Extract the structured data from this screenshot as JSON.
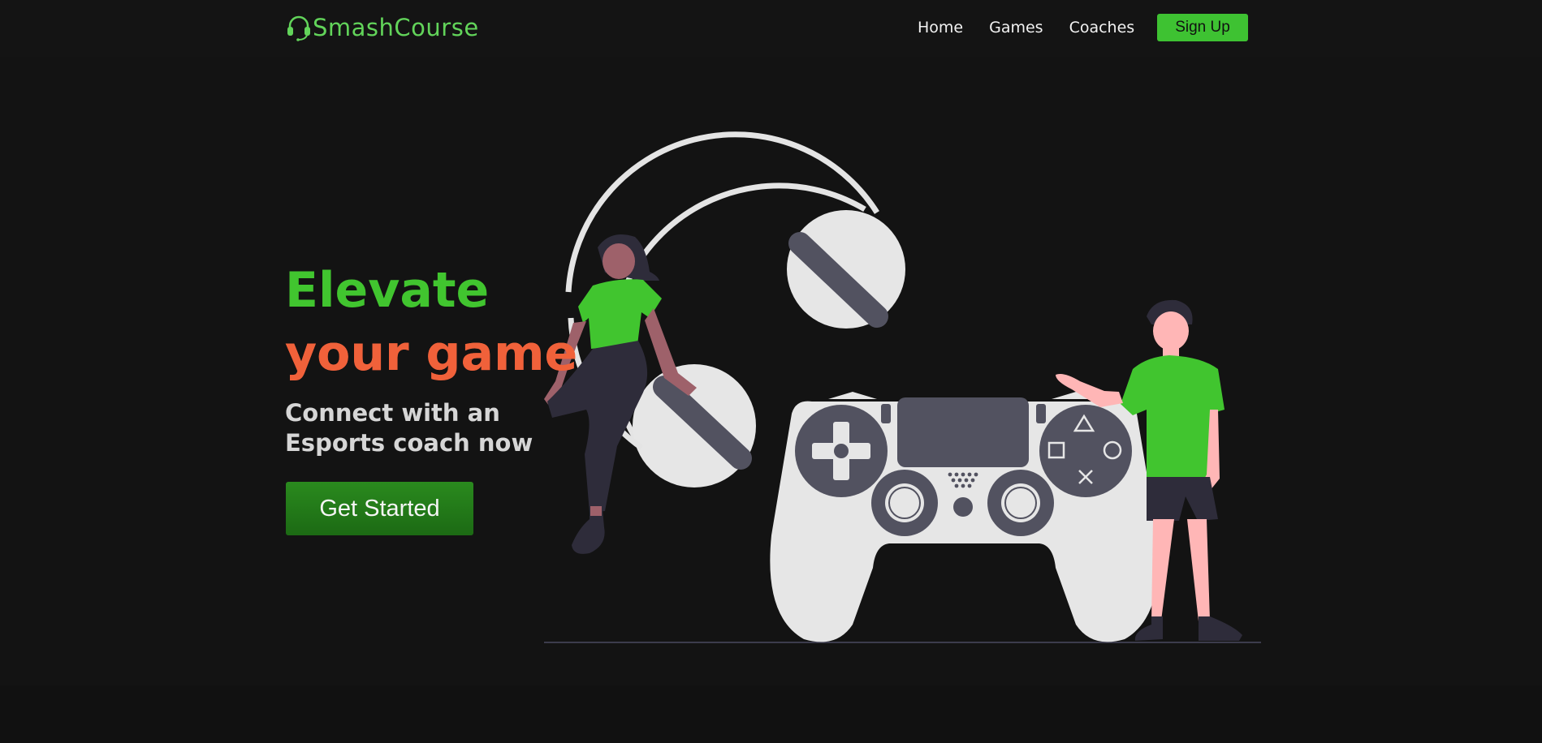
{
  "brand": {
    "name": "SmashCourse",
    "icon": "headset-icon",
    "color": "#62d45a"
  },
  "nav": {
    "links": [
      {
        "label": "Home"
      },
      {
        "label": "Games"
      },
      {
        "label": "Coaches"
      }
    ],
    "signup_label": "Sign Up",
    "signup_color": "#3ec232"
  },
  "hero": {
    "title_line1": "Elevate",
    "title_line2": "your game",
    "subtitle": "Connect with an Esports coach now",
    "cta_label": "Get Started",
    "colors": {
      "accent_green": "#41c52f",
      "accent_orange": "#f0613a",
      "background": "#131313"
    }
  },
  "illustration": {
    "icon": "gamers-with-controller-illustration"
  }
}
